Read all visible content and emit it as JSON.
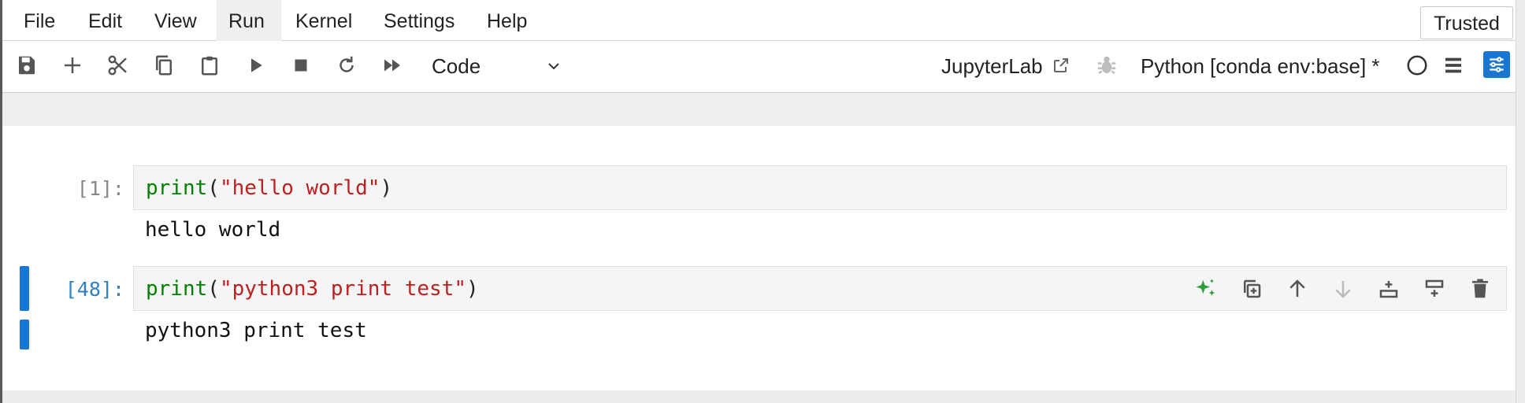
{
  "menubar": {
    "items": [
      {
        "label": "File",
        "active": false
      },
      {
        "label": "Edit",
        "active": false
      },
      {
        "label": "View",
        "active": false
      },
      {
        "label": "Run",
        "active": true
      },
      {
        "label": "Kernel",
        "active": false
      },
      {
        "label": "Settings",
        "active": false
      },
      {
        "label": "Help",
        "active": false
      }
    ],
    "trusted_label": "Trusted"
  },
  "toolbar": {
    "icons": [
      "save-icon",
      "add-cell-icon",
      "cut-icon",
      "copy-icon",
      "paste-icon",
      "run-icon",
      "stop-icon",
      "restart-icon",
      "fast-forward-icon"
    ],
    "cell_type": "Code",
    "open_in_label": "JupyterLab",
    "kernel_name": "Python [conda env:base] *",
    "kernel_status": "idle"
  },
  "cells": [
    {
      "prompt": "[1]:",
      "code": {
        "func": "print",
        "open": "(",
        "string": "\"hello world\"",
        "close": ")"
      },
      "output": "hello world",
      "active": false
    },
    {
      "prompt": "[48]:",
      "code": {
        "func": "print",
        "open": "(",
        "string": "\"python3 print test\"",
        "close": ")"
      },
      "output": "python3 print test",
      "active": true
    }
  ],
  "cell_toolbar": {
    "icons": [
      "ai-sparkle-icon",
      "duplicate-cell-icon",
      "move-up-icon",
      "move-down-icon",
      "insert-below-icon",
      "insert-above-icon",
      "delete-cell-icon"
    ]
  },
  "colors": {
    "accent": "#1976d2",
    "prompt_active": "#307fc1",
    "keyword": "#008000",
    "string": "#ba2121",
    "sparkle": "#2e9e3a"
  }
}
